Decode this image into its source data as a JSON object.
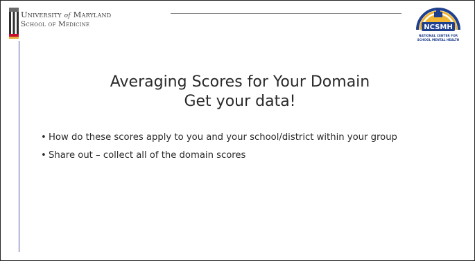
{
  "header": {
    "university_line1_part1": "University",
    "university_line1_of": "of",
    "university_line1_part2": "Maryland",
    "university_line2": "School of Medicine",
    "ncsmh_abbrev": "NCSMH",
    "ncsmh_name_line1": "NATIONAL CENTER FOR",
    "ncsmh_name_line2": "SCHOOL MENTAL HEALTH"
  },
  "slide": {
    "title_line1": "Averaging Scores for Your Domain",
    "title_line2": "Get your data!",
    "bullets": [
      "How do these scores apply to you and your school/district within your group",
      "Share out – collect all of the domain scores"
    ]
  },
  "colors": {
    "umd_red": "#c8102e",
    "umd_gold": "#e2b33b",
    "ncsmh_navy": "#1f3f8f",
    "ncsmh_gold": "#f2b632",
    "accent_line": "#4a5aa0"
  }
}
